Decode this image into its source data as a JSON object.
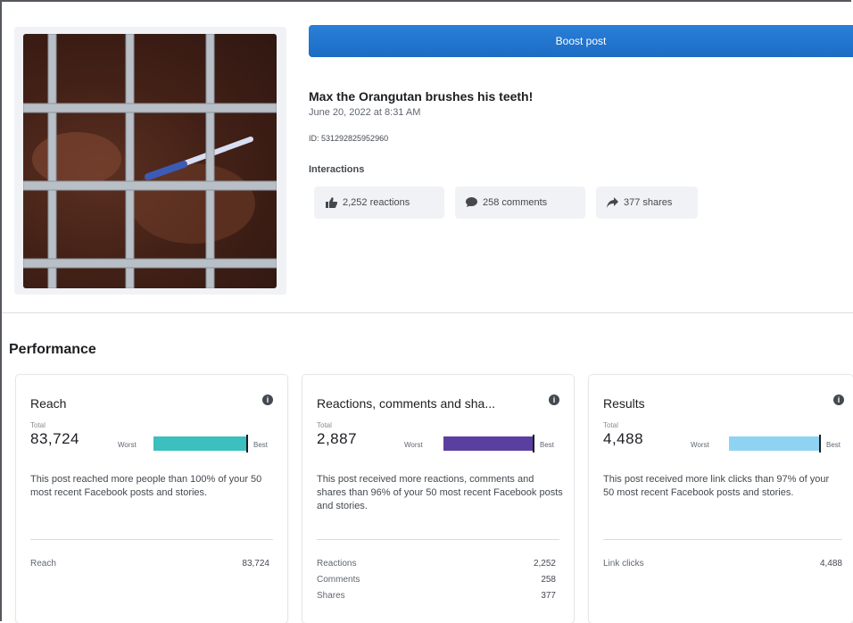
{
  "post": {
    "boost_label": "Boost post",
    "title": "Max the Orangutan brushes his teeth!",
    "date": "June 20, 2022 at 8:31 AM",
    "id": "ID: 531292825952960",
    "interactions_label": "Interactions",
    "chips": [
      {
        "icon": "thumbs-up-icon",
        "label": "2,252 reactions"
      },
      {
        "icon": "comment-icon",
        "label": "258 comments"
      },
      {
        "icon": "share-icon",
        "label": "377 shares"
      }
    ]
  },
  "performance": {
    "title": "Performance",
    "cards": [
      {
        "title": "Reach",
        "total_label": "Total",
        "total": "83,724",
        "worst": "Worst",
        "best": "Best",
        "bar_color": "#3bbfbf",
        "bar_fraction": 1.0,
        "description": "This post reached more people than 100% of your 50 most recent Facebook posts and stories.",
        "rows": [
          {
            "label": "Reach",
            "value": "83,724"
          }
        ]
      },
      {
        "title": "Reactions, comments and sha...",
        "total_label": "Total",
        "total": "2,887",
        "worst": "Worst",
        "best": "Best",
        "bar_color": "#5b3fa0",
        "bar_fraction": 0.96,
        "description": "This post received more reactions, comments and shares than 96% of your 50 most recent Facebook posts and stories.",
        "rows": [
          {
            "label": "Reactions",
            "value": "2,252"
          },
          {
            "label": "Comments",
            "value": "258"
          },
          {
            "label": "Shares",
            "value": "377"
          }
        ]
      },
      {
        "title": "Results",
        "total_label": "Total",
        "total": "4,488",
        "worst": "Worst",
        "best": "Best",
        "bar_color": "#8fd3f2",
        "bar_fraction": 0.97,
        "description": "This post received more link clicks than 97% of your 50 most recent Facebook posts and stories.",
        "rows": [
          {
            "label": "Link clicks",
            "value": "4,488"
          }
        ]
      }
    ]
  }
}
